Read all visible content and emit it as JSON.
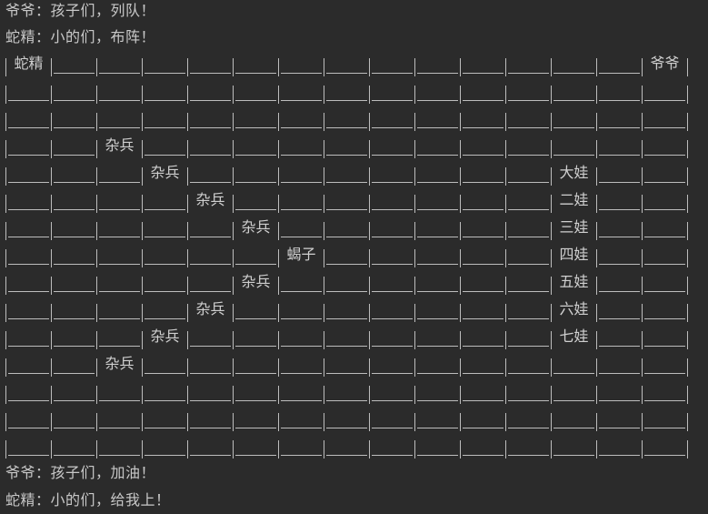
{
  "console": {
    "header_lines": [
      "爷爷：孩子们，列队！",
      "蛇精：小的们，布阵！"
    ],
    "footer_lines": [
      "爷爷：孩子们，加油！",
      "蛇精：小的们，给我上！"
    ],
    "grid": {
      "cols": 15,
      "rows": [
        [
          "蛇精",
          "",
          "",
          "",
          "",
          "",
          "",
          "",
          "",
          "",
          "",
          "",
          "",
          "",
          "爷爷"
        ],
        [
          "",
          "",
          "",
          "",
          "",
          "",
          "",
          "",
          "",
          "",
          "",
          "",
          "",
          "",
          ""
        ],
        [
          "",
          "",
          "",
          "",
          "",
          "",
          "",
          "",
          "",
          "",
          "",
          "",
          "",
          "",
          ""
        ],
        [
          "",
          "",
          "杂兵",
          "",
          "",
          "",
          "",
          "",
          "",
          "",
          "",
          "",
          "",
          "",
          ""
        ],
        [
          "",
          "",
          "",
          "杂兵",
          "",
          "",
          "",
          "",
          "",
          "",
          "",
          "",
          "大娃",
          "",
          ""
        ],
        [
          "",
          "",
          "",
          "",
          "杂兵",
          "",
          "",
          "",
          "",
          "",
          "",
          "",
          "二娃",
          "",
          ""
        ],
        [
          "",
          "",
          "",
          "",
          "",
          "杂兵",
          "",
          "",
          "",
          "",
          "",
          "",
          "三娃",
          "",
          ""
        ],
        [
          "",
          "",
          "",
          "",
          "",
          "",
          "蝎子",
          "",
          "",
          "",
          "",
          "",
          "四娃",
          "",
          ""
        ],
        [
          "",
          "",
          "",
          "",
          "",
          "杂兵",
          "",
          "",
          "",
          "",
          "",
          "",
          "五娃",
          "",
          ""
        ],
        [
          "",
          "",
          "",
          "",
          "杂兵",
          "",
          "",
          "",
          "",
          "",
          "",
          "",
          "六娃",
          "",
          ""
        ],
        [
          "",
          "",
          "",
          "杂兵",
          "",
          "",
          "",
          "",
          "",
          "",
          "",
          "",
          "七娃",
          "",
          ""
        ],
        [
          "",
          "",
          "杂兵",
          "",
          "",
          "",
          "",
          "",
          "",
          "",
          "",
          "",
          "",
          "",
          ""
        ],
        [
          "",
          "",
          "",
          "",
          "",
          "",
          "",
          "",
          "",
          "",
          "",
          "",
          "",
          "",
          ""
        ],
        [
          "",
          "",
          "",
          "",
          "",
          "",
          "",
          "",
          "",
          "",
          "",
          "",
          "",
          "",
          ""
        ],
        [
          "",
          "",
          "",
          "",
          "",
          "",
          "",
          "",
          "",
          "",
          "",
          "",
          "",
          "",
          ""
        ]
      ]
    }
  }
}
